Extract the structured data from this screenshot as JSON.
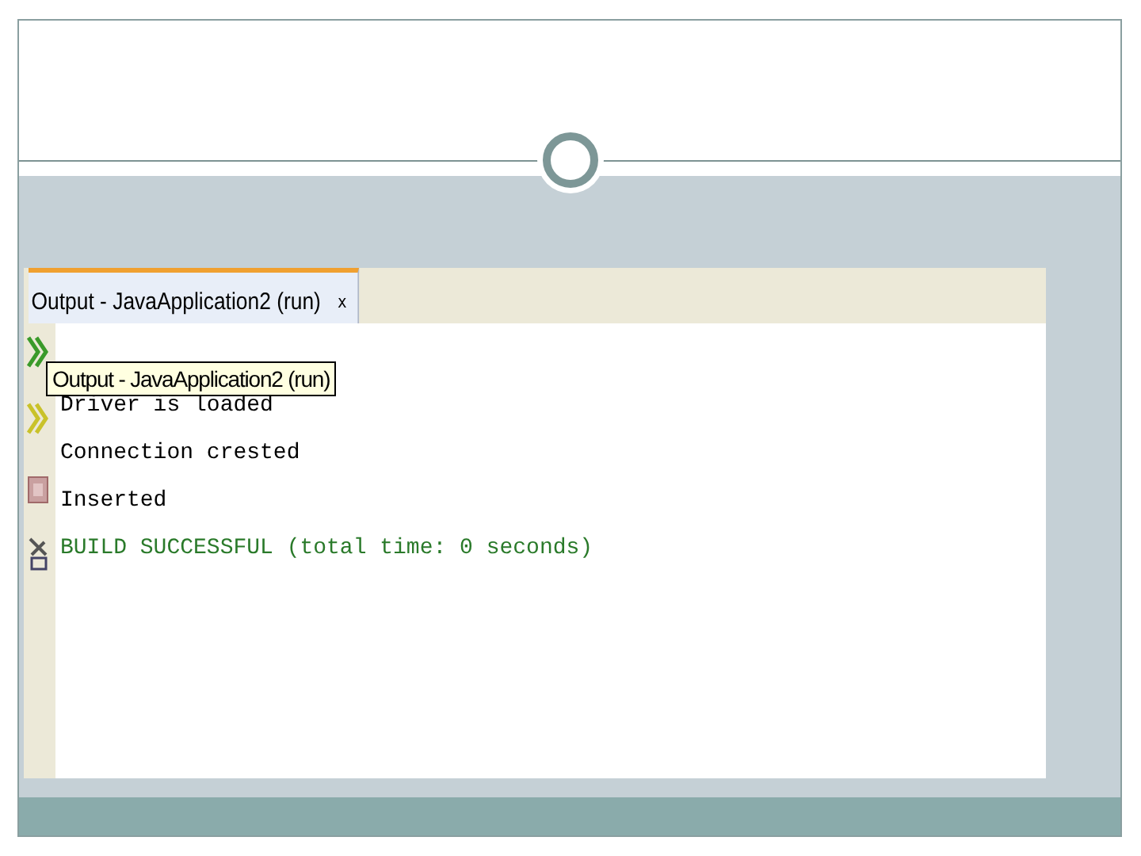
{
  "output_window": {
    "tabs": [
      {
        "label": "Output - JavaApplication2 (run)",
        "close": "x",
        "selected": true
      }
    ],
    "tooltip": "Output - JavaApplication2 (run)",
    "lines": [
      {
        "text": "Driver is loaded",
        "kind": "normal"
      },
      {
        "text": "Connection crested",
        "kind": "normal"
      },
      {
        "text": "Inserted",
        "kind": "normal"
      },
      {
        "text": "BUILD SUCCESSFUL (total time: 0 seconds)",
        "kind": "success"
      }
    ]
  }
}
